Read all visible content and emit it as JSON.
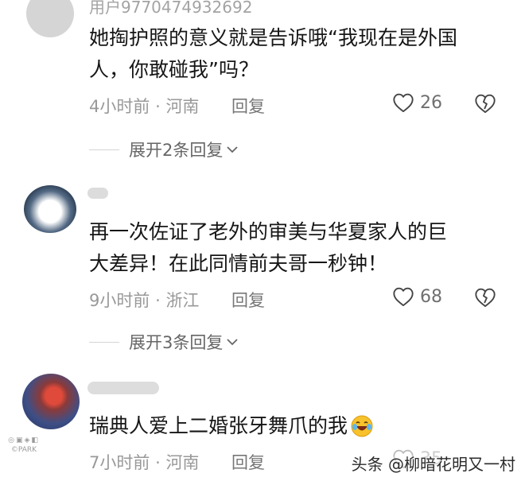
{
  "comments": [
    {
      "username": "用户97704749326​92",
      "text_line1": "她掏护照的意义就是告诉哦“我现在是外国",
      "text_line2": "人，你敢碰我”吗？",
      "time": "4小时前",
      "location": "河南",
      "reply_label": "回复",
      "likes": "26",
      "expand_label": "展开2条回复"
    },
    {
      "username": "",
      "text_line1": "再一次佐证了老外的审美与华夏家人的巨",
      "text_line2": "大差异！在此同情前夫哥一秒钟！",
      "time": "9小时前",
      "location": "浙江",
      "reply_label": "回复",
      "likes": "68",
      "expand_label": "展开3条回复"
    },
    {
      "username": "",
      "text_line1": "瑞典人爱上二婚张牙舞爪的我",
      "time": "7小时前",
      "location": "河南",
      "reply_label": "回复",
      "likes": "35"
    }
  ],
  "meta_separator": "·",
  "watermark": "头条 @柳暗花明又一村",
  "corner_watermark": "©PARK"
}
